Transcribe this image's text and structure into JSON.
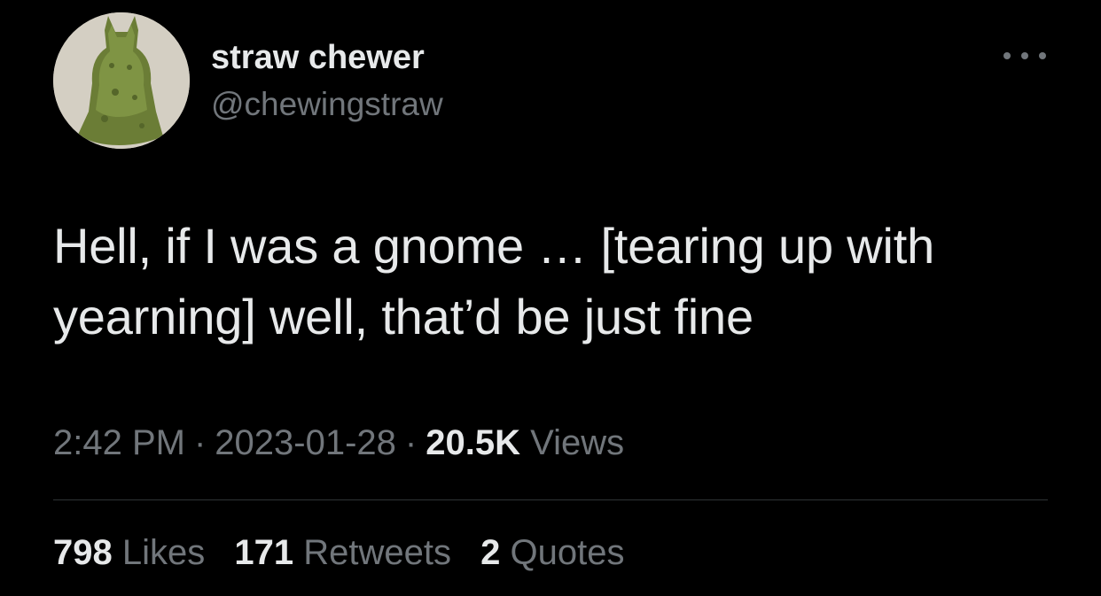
{
  "user": {
    "display_name": "straw chewer",
    "handle": "@chewingstraw"
  },
  "tweet": {
    "text": "Hell, if I was a gnome … [tearing up with yearning] well, that’d be just fine",
    "time": "2:42 PM",
    "date": "2023-01-28",
    "views_count": "20.5K",
    "views_label": "Views",
    "separator": "·"
  },
  "stats": {
    "likes_count": "798",
    "likes_label": "Likes",
    "retweets_count": "171",
    "retweets_label": "Retweets",
    "quotes_count": "2",
    "quotes_label": "Quotes"
  },
  "icons": {
    "more": "more-horizontal-icon"
  },
  "colors": {
    "background": "#000000",
    "primary_text": "#e7e9ea",
    "secondary_text": "#71767b",
    "divider": "#2f3336"
  }
}
